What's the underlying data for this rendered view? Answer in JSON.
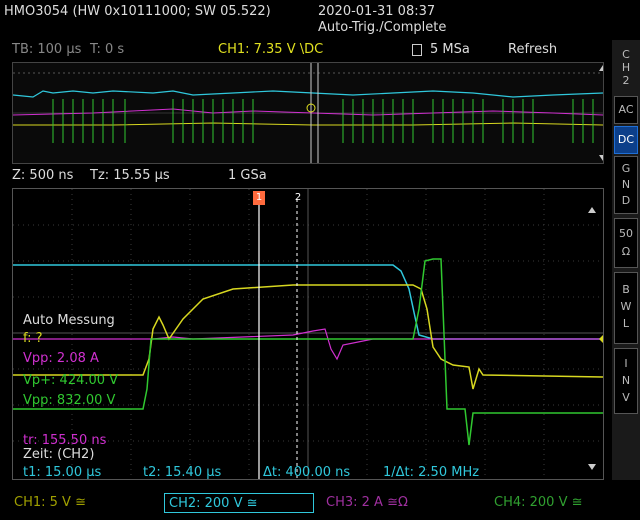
{
  "title": {
    "device": "HMO3054 (HW 0x10111000; SW 05.522)",
    "datetime": "2020-01-31 08:37",
    "status": "Auto-Trig./Complete"
  },
  "infobar": {
    "timebase": "TB: 100 µs",
    "toffset": "T: 0 s",
    "trigger": "CH1: 7.35 V \\DC",
    "sample_rate": "5 MSa",
    "mode": "Refresh"
  },
  "zoombar": {
    "zoom": "Z: 500 ns",
    "tz": "Tz: 15.55 µs",
    "rate": "1 GSa"
  },
  "sidebar": {
    "channel": "C\nH\n2",
    "buttons": [
      "AC",
      "DC",
      "G\nN\nD",
      "50\nΩ",
      "B\nW\nL",
      "I\nN\nV"
    ],
    "active": "DC"
  },
  "measurements": {
    "header": "Auto Messung",
    "freq": "f: ?",
    "vpp_ch3": "Vpp: 2.08 A",
    "vp_plus": "Vp+: 424.00 V",
    "vpp_ch4": "Vpp: 832.00 V",
    "tr": "tr: 155.50 ns",
    "zeit": "Zeit: (CH2)"
  },
  "cursors": {
    "t1": "t1: 15.00 µs",
    "t2": "t2: 15.40 µs",
    "dt": "Δt: 400.00 ns",
    "inv_dt": "1/Δt: 2.50 MHz",
    "marker1": "1",
    "marker2": "2"
  },
  "channels": [
    {
      "label": "CH1: 5 V ≅",
      "color": "#c8c800"
    },
    {
      "label": "CH2: 200 V ≅",
      "color": "#33c8d8"
    },
    {
      "label": "CH3: 2 A ≅Ω",
      "color": "#c030c0"
    },
    {
      "label": "CH4: 200 V ≅",
      "color": "#30c030"
    }
  ],
  "colors": {
    "ch1": "#d8d820",
    "ch2": "#30c8dc",
    "ch3": "#d030d0",
    "ch4": "#30c830",
    "grid": "#3a3a3a",
    "accent": "#ff6a3d"
  }
}
